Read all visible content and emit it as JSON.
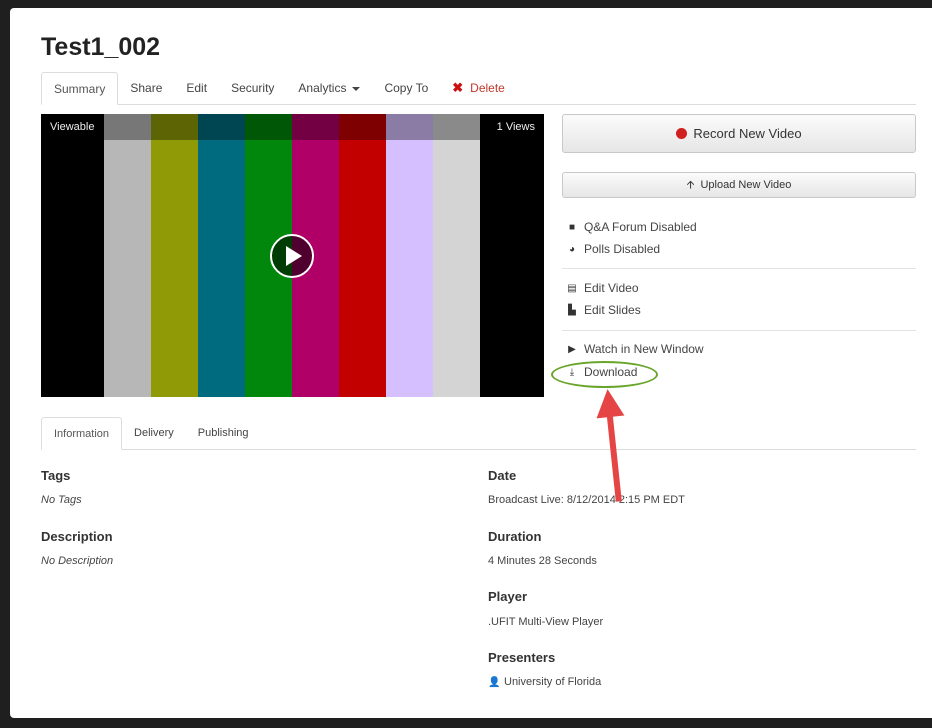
{
  "title": "Test1_002",
  "tabs": [
    {
      "label": "Summary"
    },
    {
      "label": "Share"
    },
    {
      "label": "Edit"
    },
    {
      "label": "Security"
    },
    {
      "label": "Analytics"
    },
    {
      "label": "Copy To"
    },
    {
      "label": "Delete"
    }
  ],
  "video": {
    "status_label": "Viewable",
    "views_label": "1 Views",
    "bars": [
      "#000000",
      "#b7b7b7",
      "#8f9a06",
      "#006b7f",
      "#00870c",
      "#b00067",
      "#c30000",
      "#d6bfff",
      "#d4d4d4",
      "#000000"
    ]
  },
  "actions": {
    "record_label": "Record New Video",
    "upload_label": "Upload New Video"
  },
  "side_items": {
    "qa_forum": "Q&A Forum Disabled",
    "polls": "Polls Disabled",
    "edit_video": "Edit Video",
    "edit_slides": "Edit Slides",
    "watch_new_window": "Watch in New Window",
    "download": "Download"
  },
  "info_tabs": [
    {
      "label": "Information"
    },
    {
      "label": "Delivery"
    },
    {
      "label": "Publishing"
    }
  ],
  "info": {
    "tags_label": "Tags",
    "tags_value": "No Tags",
    "description_label": "Description",
    "description_value": "No Description",
    "date_label": "Date",
    "date_value": "Broadcast Live: 8/12/2014 2:15 PM EDT",
    "duration_label": "Duration",
    "duration_value": "4 Minutes 28 Seconds",
    "player_label": "Player",
    "player_value": ".UFIT Multi-View Player",
    "presenters_label": "Presenters",
    "presenters_value": "University of Florida"
  },
  "colors": {
    "annotation_ellipse": "#69a52b",
    "annotation_arrow": "#e64545",
    "record_dot": "#d02020",
    "delete": "#cc1111"
  }
}
